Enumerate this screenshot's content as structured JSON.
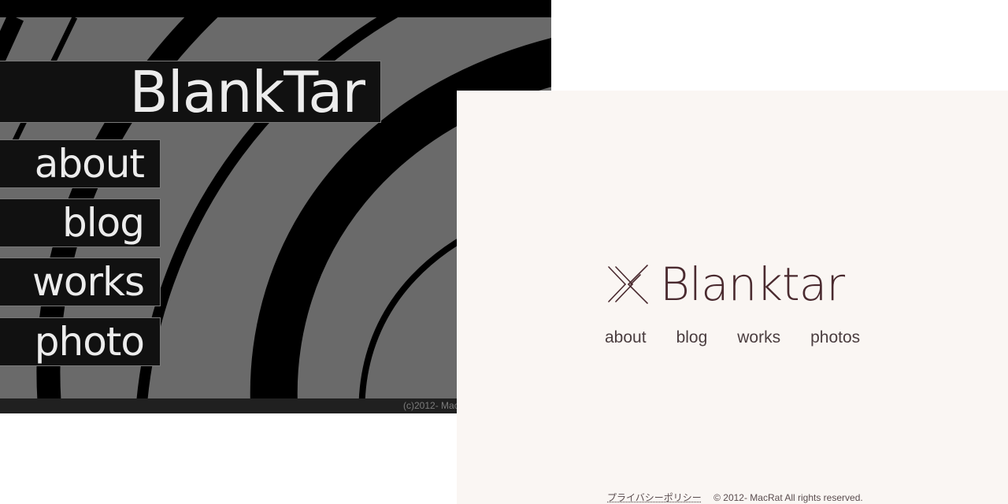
{
  "old_site": {
    "title": "BlankTar",
    "nav": [
      {
        "label": "about"
      },
      {
        "label": "blog"
      },
      {
        "label": "works"
      },
      {
        "label": "photo"
      }
    ],
    "footer": "(c)2012- Mac",
    "colors": {
      "background": "#6a6a6a",
      "arcs": "#000000",
      "box": "#111111",
      "text": "#ececec"
    }
  },
  "new_site": {
    "brand": {
      "name": "Blanktar",
      "logo_icon": "double-chevron-logo-icon"
    },
    "nav": [
      {
        "label": "about"
      },
      {
        "label": "blog"
      },
      {
        "label": "works"
      },
      {
        "label": "photos"
      }
    ],
    "footer": {
      "privacy_link": "プライバシーポリシー",
      "copyright": "© 2012- MacRat All rights reserved."
    },
    "colors": {
      "background": "#faf6f3",
      "brand": "#4a2a2f",
      "text": "#4a3d3f"
    }
  }
}
